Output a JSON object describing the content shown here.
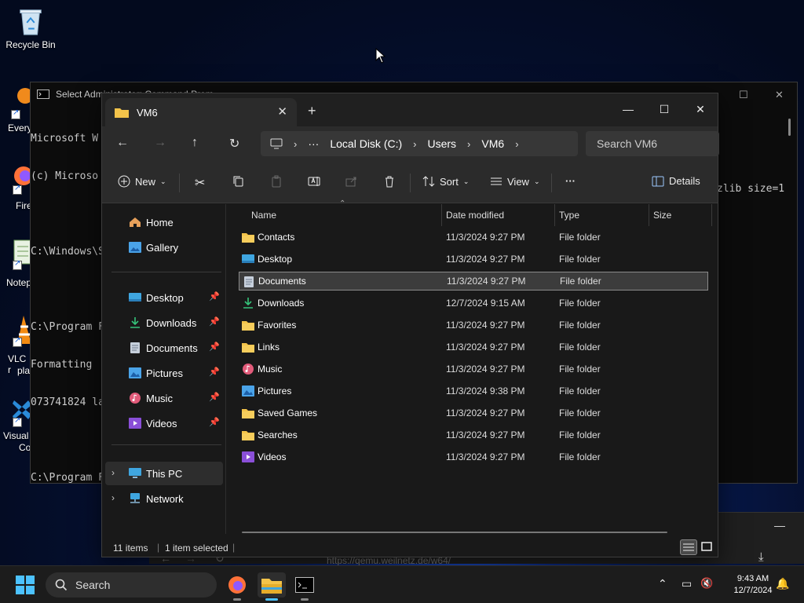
{
  "desktop": {
    "icons": [
      {
        "label": "Recycle Bin"
      },
      {
        "label": "Every"
      },
      {
        "label": "Fire"
      },
      {
        "label": "Notep"
      },
      {
        "label": "VLC r"
      },
      {
        "label": "pla"
      },
      {
        "label": "Visual"
      },
      {
        "label": "Co"
      }
    ]
  },
  "cmd_window": {
    "title": "Select Administrator: Command Prompt",
    "lines": [
      "Microsoft W",
      "(c) Microso",
      "",
      "C:\\Windows\\S",
      "",
      "C:\\Program F",
      "Formatting",
      "073741824 la",
      "",
      "C:\\Program F"
    ],
    "right_fragment": "zlib size=1"
  },
  "browser_strip": {
    "url": "https://qemu.weilnetz.de/w64/"
  },
  "explorer": {
    "tab_title": "VM6",
    "new_tab": "+",
    "address": {
      "crumbs": [
        "Local Disk (C:)",
        "Users",
        "VM6"
      ],
      "ellipsis": "···"
    },
    "search_placeholder": "Search VM6",
    "toolbar": {
      "new_label": "New",
      "sort_label": "Sort",
      "view_label": "View",
      "more_label": "···",
      "details_label": "Details"
    },
    "nav": {
      "home": "Home",
      "gallery": "Gallery",
      "quick": [
        {
          "label": "Desktop"
        },
        {
          "label": "Downloads"
        },
        {
          "label": "Documents"
        },
        {
          "label": "Pictures"
        },
        {
          "label": "Music"
        },
        {
          "label": "Videos"
        }
      ],
      "this_pc": "This PC",
      "network": "Network"
    },
    "columns": {
      "name": "Name",
      "date": "Date modified",
      "type": "Type",
      "size": "Size"
    },
    "rows": [
      {
        "name": "Contacts",
        "date": "11/3/2024 9:27 PM",
        "type": "File folder",
        "icon": "folder-icon"
      },
      {
        "name": "Desktop",
        "date": "11/3/2024 9:27 PM",
        "type": "File folder",
        "icon": "desktop-folder-icon"
      },
      {
        "name": "Documents",
        "date": "11/3/2024 9:27 PM",
        "type": "File folder",
        "icon": "documents-folder-icon"
      },
      {
        "name": "Downloads",
        "date": "12/7/2024 9:15 AM",
        "type": "File folder",
        "icon": "downloads-folder-icon"
      },
      {
        "name": "Favorites",
        "date": "11/3/2024 9:27 PM",
        "type": "File folder",
        "icon": "folder-icon"
      },
      {
        "name": "Links",
        "date": "11/3/2024 9:27 PM",
        "type": "File folder",
        "icon": "folder-icon"
      },
      {
        "name": "Music",
        "date": "11/3/2024 9:27 PM",
        "type": "File folder",
        "icon": "music-folder-icon"
      },
      {
        "name": "Pictures",
        "date": "11/3/2024 9:38 PM",
        "type": "File folder",
        "icon": "pictures-folder-icon"
      },
      {
        "name": "Saved Games",
        "date": "11/3/2024 9:27 PM",
        "type": "File folder",
        "icon": "folder-icon"
      },
      {
        "name": "Searches",
        "date": "11/3/2024 9:27 PM",
        "type": "File folder",
        "icon": "folder-icon"
      },
      {
        "name": "Videos",
        "date": "11/3/2024 9:27 PM",
        "type": "File folder",
        "icon": "videos-folder-icon"
      }
    ],
    "selected_row": "Documents",
    "status": {
      "items": "11 items",
      "selected": "1 item selected"
    }
  },
  "taskbar": {
    "search_label": "Search",
    "time": "9:43 AM",
    "date": "12/7/2024"
  },
  "colors": {
    "folder": "#f3c34a",
    "accent": "#4cc2ff",
    "window_bg": "#191919",
    "toolbar_bg": "#2b2b2b"
  }
}
